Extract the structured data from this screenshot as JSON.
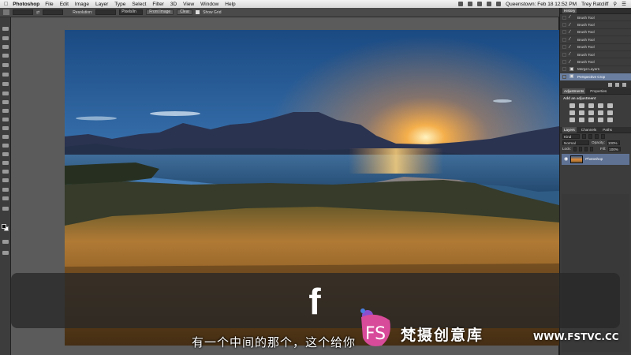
{
  "menubar": {
    "app_name": "Photoshop",
    "items": [
      "File",
      "Edit",
      "Image",
      "Layer",
      "Type",
      "Select",
      "Filter",
      "3D",
      "View",
      "Window",
      "Help"
    ],
    "status": "Queenstown: Feb 18  12:52 PM",
    "user": "Trey Ratcliff"
  },
  "options_bar": {
    "resolution_label": "Resolution:",
    "units": "Pixels/in",
    "front_image_label": "Front Image",
    "clear_label": "Clear",
    "show_grid_label": "Show Grid"
  },
  "history_panel": {
    "title": "History",
    "items": [
      {
        "label": "Brush Tool",
        "selected": false
      },
      {
        "label": "Brush Tool",
        "selected": false
      },
      {
        "label": "Brush Tool",
        "selected": false
      },
      {
        "label": "Brush Tool",
        "selected": false
      },
      {
        "label": "Brush Tool",
        "selected": false
      },
      {
        "label": "Brush Tool",
        "selected": false
      },
      {
        "label": "Brush Tool",
        "selected": false
      },
      {
        "label": "Merge Layers",
        "selected": false
      },
      {
        "label": "Perspective Crop",
        "selected": true
      }
    ]
  },
  "adjustments_panel": {
    "tabs": [
      "Adjustments",
      "Properties"
    ],
    "heading": "Add an adjustment"
  },
  "layers_panel": {
    "tabs": [
      "Layers",
      "Channels",
      "Paths"
    ],
    "kind_label": "Kind",
    "blend_mode": "Normal",
    "opacity_label": "Opacity:",
    "opacity_value": "100%",
    "lock_label": "Lock:",
    "fill_label": "Fill:",
    "fill_value": "100%",
    "layer_name": "Photoshop"
  },
  "overlay": {
    "glyph": "f",
    "subtitle": "有一个中间的那个，这个给你"
  },
  "watermark": {
    "brand": "梵摄创意库",
    "url": "WWW.FSTVC.CC",
    "colors": {
      "logo_pink": "#d84b9a",
      "logo_purple": "#8a4fd1",
      "logo_blue": "#4a7ee0"
    }
  }
}
